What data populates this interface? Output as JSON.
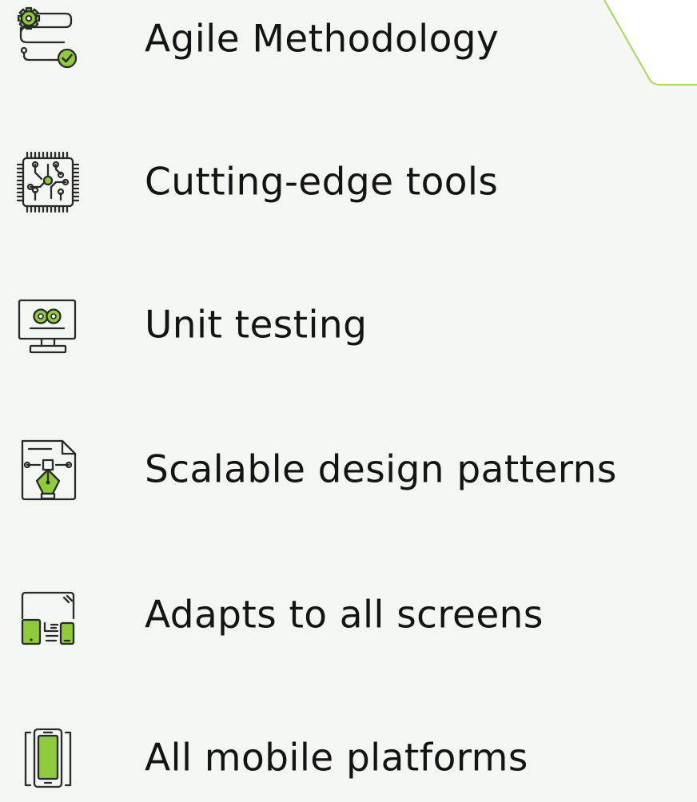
{
  "colors": {
    "background": "#f3f6f1",
    "text": "#141414",
    "icon_accent": "#8fcb3b",
    "icon_stroke": "#2a2a2a",
    "card_outline": "#a8d85a"
  },
  "features": [
    {
      "label": "Agile Methodology",
      "icon": "agile-workflow-icon"
    },
    {
      "label": "Cutting-edge tools",
      "icon": "circuit-chip-icon"
    },
    {
      "label": "Unit testing",
      "icon": "monitor-infinity-icon"
    },
    {
      "label": "Scalable design patterns",
      "icon": "pen-tool-document-icon"
    },
    {
      "label": "Adapts to all screens",
      "icon": "responsive-devices-icon"
    },
    {
      "label": "All mobile platforms",
      "icon": "smartphone-icon"
    }
  ]
}
